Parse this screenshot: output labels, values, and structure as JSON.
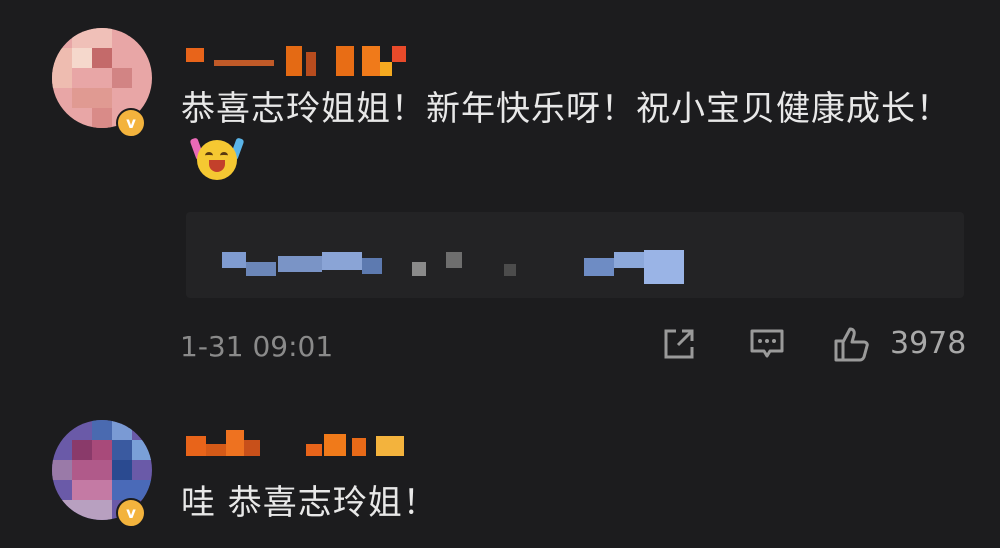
{
  "colors": {
    "background": "#1c1c1e",
    "quote_background": "#232325",
    "verified_badge": "#f3b33d",
    "text": "#e8e8e8",
    "meta": "#8a8a8a"
  },
  "comments": [
    {
      "avatar_icon": "pixelated-avatar",
      "verified_icon": "verified-v-badge",
      "text": "恭喜志玲姐姐！新年快乐呀！祝小宝贝健康成长！",
      "emoji_icon": "cheering-emoji",
      "date": "1-31 09:01",
      "likes": "3978"
    },
    {
      "avatar_icon": "pixelated-avatar",
      "verified_icon": "verified-v-badge",
      "text": "哇 恭喜志玲姐！"
    }
  ],
  "actions": {
    "share_icon": "share-icon",
    "reply_icon": "comment-icon",
    "like_icon": "thumbs-up-icon"
  }
}
